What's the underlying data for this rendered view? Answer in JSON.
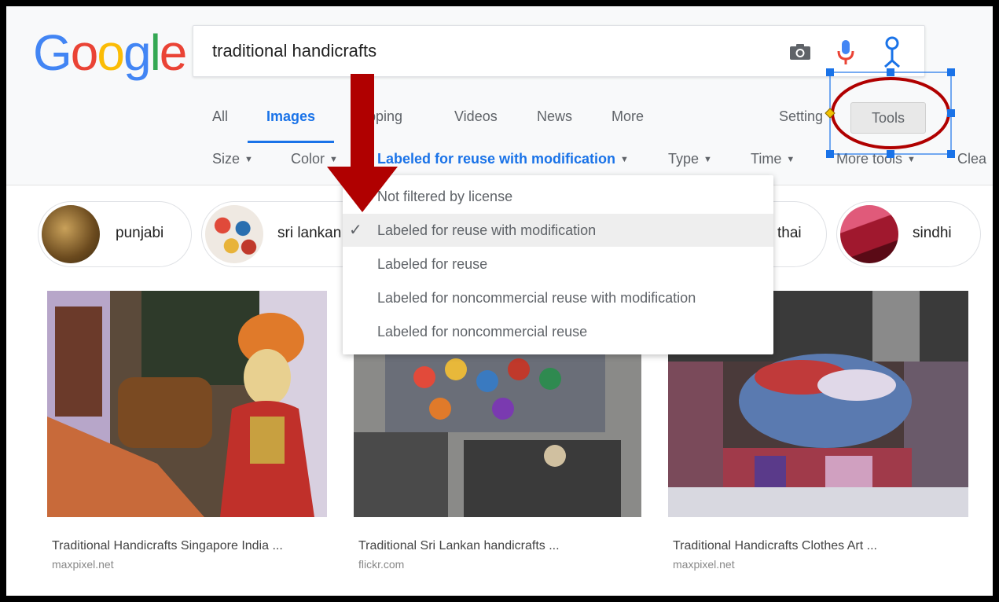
{
  "logo": {
    "letters": [
      "G",
      "o",
      "o",
      "g",
      "l",
      "e"
    ],
    "colors": [
      "#4285f4",
      "#ea4335",
      "#fbbc05",
      "#4285f4",
      "#34a853",
      "#ea4335"
    ]
  },
  "search": {
    "query": "traditional handicrafts"
  },
  "tabs": [
    {
      "label": "All",
      "active": false
    },
    {
      "label": "Images",
      "active": true
    },
    {
      "label": "opping",
      "active": false
    },
    {
      "label": "Videos",
      "active": false
    },
    {
      "label": "News",
      "active": false
    },
    {
      "label": "More",
      "active": false
    }
  ],
  "settings_label": "Setting",
  "tools_label": "Tools",
  "filters": [
    {
      "label": "Size",
      "active": false
    },
    {
      "label": "Color",
      "active": false
    },
    {
      "label": "Labeled for reuse with modification",
      "active": true
    },
    {
      "label": "Type",
      "active": false
    },
    {
      "label": "Time",
      "active": false
    },
    {
      "label": "More tools",
      "active": false
    },
    {
      "label": "Clea",
      "active": false
    }
  ],
  "chips": [
    {
      "label": "punjabi"
    },
    {
      "label": "sri lankan"
    },
    {
      "label": "thai"
    },
    {
      "label": "sindhi"
    }
  ],
  "dropdown": {
    "items": [
      {
        "label": "Not filtered by license",
        "selected": false
      },
      {
        "label": "Labeled for reuse with modification",
        "selected": true
      },
      {
        "label": "Labeled for reuse",
        "selected": false
      },
      {
        "label": "Labeled for noncommercial reuse with modification",
        "selected": false
      },
      {
        "label": "Labeled for noncommercial reuse",
        "selected": false
      }
    ],
    "check_glyph": "✓"
  },
  "results": [
    {
      "title": "Traditional Handicrafts Singapore India ...",
      "source": "maxpixel.net"
    },
    {
      "title": "Traditional Sri Lankan handicrafts ...",
      "source": "flickr.com"
    },
    {
      "title": "Traditional Handicrafts Clothes Art ...",
      "source": "maxpixel.net"
    }
  ],
  "colors": {
    "accent": "#1a73e8",
    "annotation_red": "#b00000",
    "selection_blue": "#1a73e8"
  }
}
